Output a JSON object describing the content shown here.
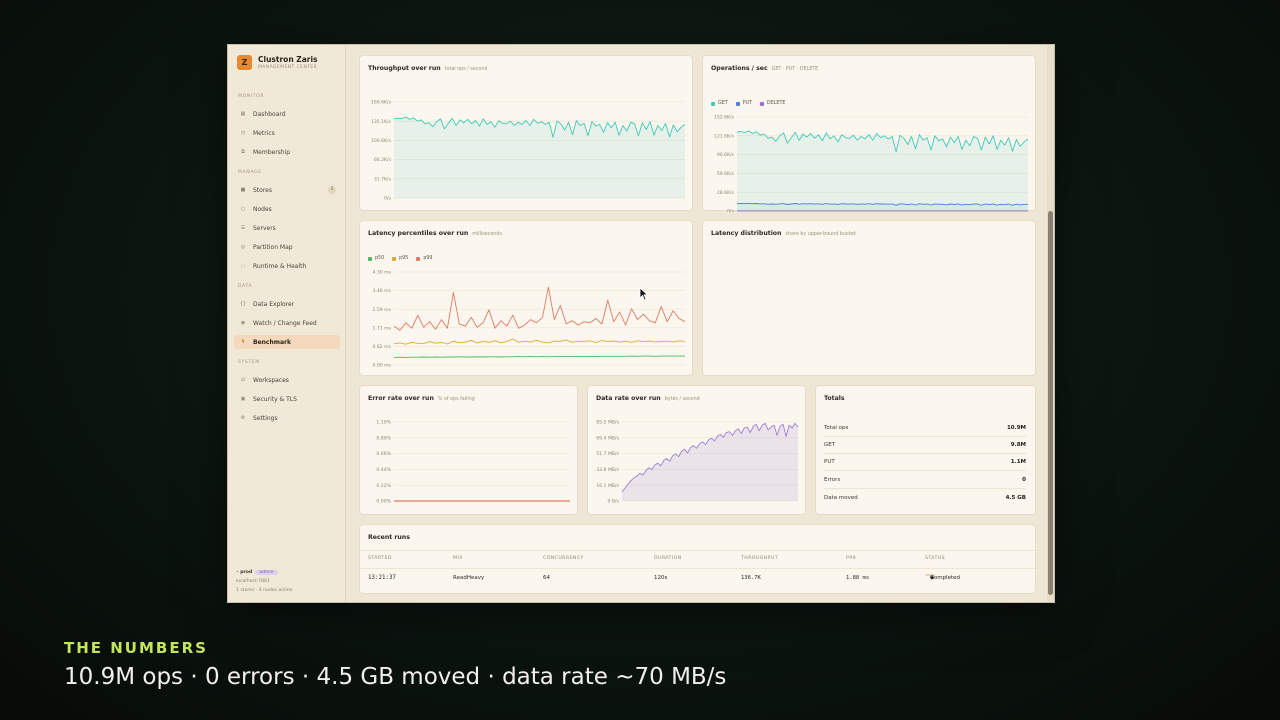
{
  "brand": {
    "logo": "Z",
    "name": "Clustron Zaris",
    "sub": "MANAGEMENT CENTER"
  },
  "nav": {
    "sections": [
      {
        "label": "MONITOR",
        "items": [
          {
            "label": "Dashboard",
            "icon": "grid-icon"
          },
          {
            "label": "Metrics",
            "icon": "clock-icon"
          },
          {
            "label": "Membership",
            "icon": "people-icon"
          }
        ]
      },
      {
        "label": "MANAGE",
        "items": [
          {
            "label": "Stores",
            "icon": "store-icon",
            "badge": "1"
          },
          {
            "label": "Nodes",
            "icon": "circle-icon"
          },
          {
            "label": "Servers",
            "icon": "server-icon"
          },
          {
            "label": "Partition Map",
            "icon": "map-icon"
          },
          {
            "label": "Runtime & Health",
            "icon": "health-icon"
          }
        ]
      },
      {
        "label": "DATA",
        "items": [
          {
            "label": "Data Explorer",
            "icon": "braces-icon"
          },
          {
            "label": "Watch / Change Feed",
            "icon": "eye-icon"
          },
          {
            "label": "Benchmark",
            "icon": "bolt-icon",
            "active": true
          }
        ]
      },
      {
        "label": "SYSTEM",
        "items": [
          {
            "label": "Workspaces",
            "icon": "swap-icon"
          },
          {
            "label": "Security & TLS",
            "icon": "lock-icon"
          },
          {
            "label": "Settings",
            "icon": "gear-icon"
          }
        ]
      }
    ]
  },
  "footer": {
    "env": "prod",
    "env_badge": "admin",
    "host": "localhost:7881",
    "status": "1 stores · 4 nodes online"
  },
  "cards": {
    "throughput": {
      "title": "Throughput over run",
      "sub": "total ops / second"
    },
    "operations": {
      "title": "Operations / sec",
      "sub": "GET · PUT · DELETE"
    },
    "latency_pct": {
      "title": "Latency percentiles over run",
      "sub": "milliseconds"
    },
    "latency_dist": {
      "title": "Latency distribution",
      "sub": "share by upper-bound bucket"
    },
    "error_rate": {
      "title": "Error rate over run",
      "sub": "% of ops failing"
    },
    "data_rate": {
      "title": "Data rate over run",
      "sub": "bytes / second"
    },
    "totals": {
      "title": "Totals"
    },
    "recent": {
      "title": "Recent runs"
    }
  },
  "totals": [
    {
      "label": "Total ops",
      "value": "10.9M"
    },
    {
      "label": "GET",
      "value": "9.8M"
    },
    {
      "label": "PUT",
      "value": "1.1M"
    },
    {
      "label": "Errors",
      "value": "0"
    },
    {
      "label": "Data moved",
      "value": "4.5 GB"
    }
  ],
  "recent_runs": {
    "columns": [
      "STARTED",
      "MIX",
      "CONCURRENCY",
      "DURATION",
      "THROUGHPUT",
      "P99",
      "STATUS"
    ],
    "rows": [
      {
        "started": "13:21:37",
        "mix": "ReadHeavy",
        "concurrency": "64",
        "duration": "120s",
        "throughput": "136.7K",
        "p99": "1.88 ms",
        "status": "Completed"
      }
    ]
  },
  "caption": {
    "kicker": "THE NUMBERS",
    "main": "10.9M ops · 0 errors · 4.5 GB moved · data rate ~70 MB/s"
  },
  "colors": {
    "accent": "#e8892e",
    "get": "#3ec9b8",
    "put": "#4a7fd8",
    "delete": "#9a6ad8",
    "p50": "#4cb860",
    "p95": "#e0a838",
    "p99": "#e07a62",
    "data": "#9b7fd4"
  },
  "chart_data": [
    {
      "id": "throughput",
      "type": "area",
      "y_ticks": [
        "0/s",
        "31.7K/s",
        "66.2K/s",
        "100.6K/s",
        "135.1K/s",
        "169.6K/s"
      ],
      "ylim": [
        0,
        169600
      ],
      "series": [
        {
          "values": [
            140000,
            141000,
            140500,
            143000,
            139000,
            141500,
            136000,
            138000,
            131000,
            133000,
            126000,
            135000,
            140000,
            122000,
            132000,
            141000,
            128000,
            138000,
            133000,
            139000,
            131000,
            137000,
            127000,
            140000,
            130000,
            135000,
            125000,
            137000,
            132000,
            131000,
            136000,
            128000,
            134000,
            130000,
            137000,
            128000,
            139000,
            132000,
            135000,
            130000,
            134000,
            107000,
            136000,
            131000,
            120000,
            134000,
            112000,
            137000,
            128000,
            132000,
            110000,
            135000,
            127000,
            130000,
            116000,
            133000,
            124000,
            134000,
            111000,
            128000,
            118000,
            134000,
            131000,
            110000,
            133000,
            121000,
            135000,
            111000,
            128000,
            119000,
            132000,
            108000,
            129000,
            117000,
            125000,
            130000
          ]
        }
      ]
    },
    {
      "id": "operations",
      "type": "line",
      "legend": [
        "GET",
        "PUT",
        "DELETE"
      ],
      "y_ticks": [
        "0/s",
        "28.6K/s",
        "59.6K/s",
        "90.6K/s",
        "121.6K/s",
        "152.6K/s"
      ],
      "ylim": [
        0,
        152600
      ],
      "series": [
        {
          "name": "GET",
          "values": [
            128000,
            129000,
            127500,
            130000,
            126000,
            128500,
            123000,
            125000,
            118000,
            120000,
            113000,
            122000,
            127000,
            110000,
            119000,
            128000,
            115000,
            125000,
            120000,
            126000,
            118000,
            124000,
            114000,
            127000,
            117000,
            122000,
            112000,
            124000,
            119000,
            118000,
            123000,
            115000,
            121000,
            117000,
            124000,
            115000,
            126000,
            119000,
            122000,
            117000,
            121000,
            96000,
            123000,
            118000,
            108000,
            121000,
            101000,
            124000,
            115000,
            119000,
            99000,
            122000,
            114000,
            117000,
            104000,
            120000,
            111000,
            121000,
            100000,
            115000,
            106000,
            121000,
            118000,
            99000,
            120000,
            109000,
            122000,
            100000,
            115000,
            107000,
            119000,
            97000,
            116000,
            105000,
            112000,
            117000
          ]
        },
        {
          "name": "PUT",
          "values": [
            12000,
            12200,
            11800,
            12500,
            11900,
            12100,
            11500,
            11700,
            11000,
            11300,
            10800,
            11600,
            12000,
            10500,
            11300,
            12100,
            11000,
            11800,
            11400,
            11900,
            11200,
            11700,
            10900,
            12000,
            11100,
            11600,
            10700,
            11800,
            11300,
            11200,
            11700,
            10900,
            11500,
            11100,
            11800,
            10900,
            11900,
            11300,
            11600,
            11100,
            11500,
            9200,
            11700,
            11200,
            10300,
            11500,
            9700,
            11800,
            10900,
            11300,
            9500,
            11600,
            10800,
            11100,
            9900,
            11400,
            10600,
            11500,
            9600,
            10900,
            10100,
            11500,
            11200,
            9400,
            11400,
            10400,
            11600,
            9500,
            10900,
            10200,
            11300,
            9300,
            11000,
            10000,
            10700,
            11100
          ]
        },
        {
          "name": "DELETE",
          "values": [
            200,
            200,
            200,
            200,
            200,
            200,
            200,
            200,
            200,
            200,
            200,
            200,
            200,
            200,
            200,
            200,
            200,
            200,
            200,
            200,
            200,
            200,
            200,
            200,
            200,
            200,
            200,
            200,
            200,
            200,
            200,
            200,
            200,
            200,
            200,
            200,
            200,
            200,
            200,
            200,
            200,
            200,
            200,
            200,
            200,
            200,
            200,
            200,
            200,
            200,
            200,
            200,
            200,
            200,
            200,
            200,
            200,
            200,
            200,
            200,
            200,
            200,
            200,
            200,
            200,
            200,
            200,
            200,
            200,
            200,
            200,
            200,
            200,
            200,
            200,
            200
          ]
        }
      ]
    },
    {
      "id": "latency_pct",
      "type": "line",
      "legend": [
        "p50",
        "p95",
        "p99"
      ],
      "y_ticks": [
        "0.00 ms",
        "0.82 ms",
        "1.71 ms",
        "2.59 ms",
        "3.46 ms",
        "4.30 ms"
      ],
      "ylim": [
        0,
        4.3
      ],
      "series": [
        {
          "name": "p50",
          "values": [
            0.35,
            0.36,
            0.35,
            0.36,
            0.36,
            0.37,
            0.36,
            0.37,
            0.36,
            0.37,
            0.37,
            0.38,
            0.37,
            0.37,
            0.38,
            0.37,
            0.38,
            0.38,
            0.37,
            0.38,
            0.38,
            0.39,
            0.38,
            0.39,
            0.38,
            0.39,
            0.38,
            0.39,
            0.39,
            0.39,
            0.39,
            0.4,
            0.39,
            0.4,
            0.39,
            0.4,
            0.4,
            0.4,
            0.4,
            0.4,
            0.41,
            0.4,
            0.41,
            0.41,
            0.4,
            0.41,
            0.41,
            0.41,
            0.41,
            0.41
          ]
        },
        {
          "name": "p95",
          "values": [
            0.98,
            1.02,
            0.96,
            1.05,
            1.0,
            0.99,
            1.08,
            1.01,
            1.04,
            0.97,
            1.1,
            1.03,
            1.06,
            1.14,
            1.02,
            1.09,
            1.05,
            1.12,
            1.03,
            1.08,
            1.2,
            1.05,
            1.1,
            1.07,
            1.14,
            1.06,
            1.02,
            1.11,
            1.09,
            1.16,
            1.05,
            1.1,
            1.08,
            1.12,
            1.04,
            1.13,
            1.09,
            1.11,
            1.06,
            1.1,
            1.05,
            1.12,
            1.08,
            1.11,
            1.06,
            1.09,
            1.1,
            1.07,
            1.12,
            1.08
          ]
        },
        {
          "name": "p99",
          "values": [
            1.8,
            1.6,
            1.95,
            1.7,
            2.3,
            1.75,
            2.0,
            1.65,
            2.1,
            1.7,
            3.35,
            1.9,
            1.8,
            2.2,
            1.75,
            1.95,
            2.55,
            1.7,
            2.05,
            1.8,
            2.3,
            1.7,
            1.85,
            2.1,
            1.95,
            2.2,
            3.6,
            2.1,
            2.75,
            1.9,
            2.05,
            1.85,
            2.0,
            1.95,
            2.15,
            1.9,
            3.0,
            2.0,
            2.45,
            1.85,
            2.6,
            2.1,
            2.35,
            2.05,
            1.95,
            2.7,
            2.0,
            2.5,
            2.15,
            2.0
          ]
        }
      ]
    },
    {
      "id": "error_rate",
      "type": "line",
      "y_ticks": [
        "0.00%",
        "0.22%",
        "0.44%",
        "0.66%",
        "0.89%",
        "1.10%"
      ],
      "ylim": [
        0,
        1.1
      ],
      "series": [
        {
          "values": [
            0,
            0,
            0,
            0,
            0,
            0,
            0,
            0,
            0,
            0,
            0,
            0,
            0,
            0,
            0,
            0,
            0,
            0,
            0,
            0
          ]
        }
      ]
    },
    {
      "id": "data_rate",
      "type": "area",
      "y_ticks": [
        "0 B/s",
        "16.1 MB/s",
        "33.8 MB/s",
        "51.7 MB/s",
        "69.4 MB/s",
        "85.5 MB/s"
      ],
      "ylim": [
        0,
        85.5
      ],
      "series": [
        {
          "values": [
            10,
            14,
            18,
            22,
            25,
            27,
            30,
            28,
            33,
            36,
            34,
            39,
            41,
            38,
            44,
            46,
            43,
            49,
            51,
            48,
            54,
            56,
            52,
            58,
            60,
            57,
            62,
            64,
            61,
            66,
            68,
            65,
            70,
            72,
            69,
            74,
            75,
            71,
            76,
            78,
            73,
            79,
            80,
            74,
            81,
            83,
            76,
            82,
            84,
            77,
            80,
            82,
            71,
            81,
            83,
            70,
            82,
            79,
            84,
            80
          ]
        }
      ]
    }
  ]
}
